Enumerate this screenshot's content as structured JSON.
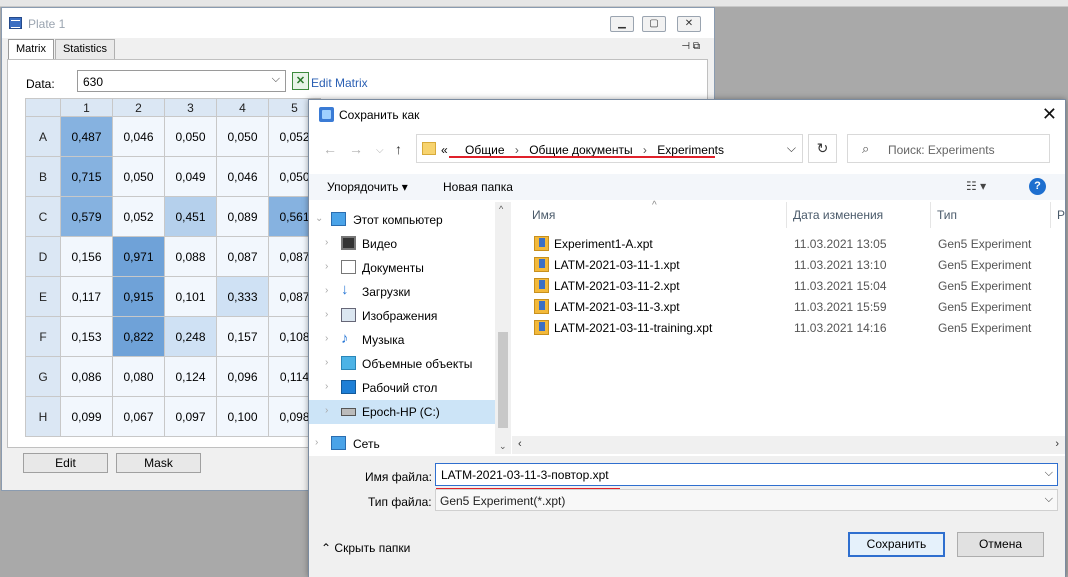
{
  "plate": {
    "title": "Plate 1",
    "tabs": [
      "Matrix",
      "Statistics"
    ],
    "data_label": "Data:",
    "data_value": "630",
    "edit_matrix": "Edit Matrix",
    "columns": [
      "1",
      "2",
      "3",
      "4",
      "5"
    ],
    "rows": [
      {
        "label": "A",
        "values": [
          "0,487",
          "0,046",
          "0,050",
          "0,050",
          "0,052"
        ]
      },
      {
        "label": "B",
        "values": [
          "0,715",
          "0,050",
          "0,049",
          "0,046",
          "0,050"
        ]
      },
      {
        "label": "C",
        "values": [
          "0,579",
          "0,052",
          "0,451",
          "0,089",
          "0,561"
        ]
      },
      {
        "label": "D",
        "values": [
          "0,156",
          "0,971",
          "0,088",
          "0,087",
          "0,087"
        ]
      },
      {
        "label": "E",
        "values": [
          "0,117",
          "0,915",
          "0,101",
          "0,333",
          "0,087"
        ]
      },
      {
        "label": "F",
        "values": [
          "0,153",
          "0,822",
          "0,248",
          "0,157",
          "0,108"
        ]
      },
      {
        "label": "G",
        "values": [
          "0,086",
          "0,080",
          "0,124",
          "0,096",
          "0,114"
        ]
      },
      {
        "label": "H",
        "values": [
          "0,099",
          "0,067",
          "0,097",
          "0,100",
          "0,098"
        ]
      }
    ],
    "edit_button": "Edit",
    "mask_button": "Mask"
  },
  "dialog": {
    "title": "Сохранить как",
    "breadcrumbs": [
      "Общие",
      "Общие документы",
      "Experiments"
    ],
    "breadcrumb_prefix": "«",
    "search_placeholder": "Поиск: Experiments",
    "organize": "Упорядочить ▾",
    "new_folder": "Новая папка",
    "nav": [
      {
        "label": "Этот компьютер",
        "icon": "computer-icon"
      },
      {
        "label": "Видео",
        "icon": "video-icon"
      },
      {
        "label": "Документы",
        "icon": "documents-icon"
      },
      {
        "label": "Загрузки",
        "icon": "downloads-icon"
      },
      {
        "label": "Изображения",
        "icon": "pictures-icon"
      },
      {
        "label": "Музыка",
        "icon": "music-icon"
      },
      {
        "label": "Объемные объекты",
        "icon": "3d-objects-icon"
      },
      {
        "label": "Рабочий стол",
        "icon": "desktop-icon"
      },
      {
        "label": "Epoch-HP (C:)",
        "icon": "drive-icon"
      },
      {
        "label": "Сеть",
        "icon": "network-icon"
      }
    ],
    "columns": {
      "name": "Имя",
      "date": "Дата изменения",
      "type": "Тип",
      "extra": "Р"
    },
    "files": [
      {
        "name": "Experiment1-A.xpt",
        "date": "11.03.2021 13:05",
        "type": "Gen5 Experiment"
      },
      {
        "name": "LATM-2021-03-11-1.xpt",
        "date": "11.03.2021 13:10",
        "type": "Gen5 Experiment"
      },
      {
        "name": "LATM-2021-03-11-2.xpt",
        "date": "11.03.2021 15:04",
        "type": "Gen5 Experiment"
      },
      {
        "name": "LATM-2021-03-11-3.xpt",
        "date": "11.03.2021 15:59",
        "type": "Gen5 Experiment"
      },
      {
        "name": "LATM-2021-03-11-training.xpt",
        "date": "11.03.2021 14:16",
        "type": "Gen5 Experiment"
      }
    ],
    "filename_label": "Имя файла:",
    "filename_value": "LATM-2021-03-11-3-повтор.xpt",
    "filetype_label": "Тип файла:",
    "filetype_value": "Gen5 Experiment(*.xpt)",
    "hide_folders": "Скрыть папки",
    "save_button": "Сохранить",
    "cancel_button": "Отмена"
  },
  "colors": {
    "highlight_underline": "#e0202a",
    "accent": "#2f6fcf"
  }
}
